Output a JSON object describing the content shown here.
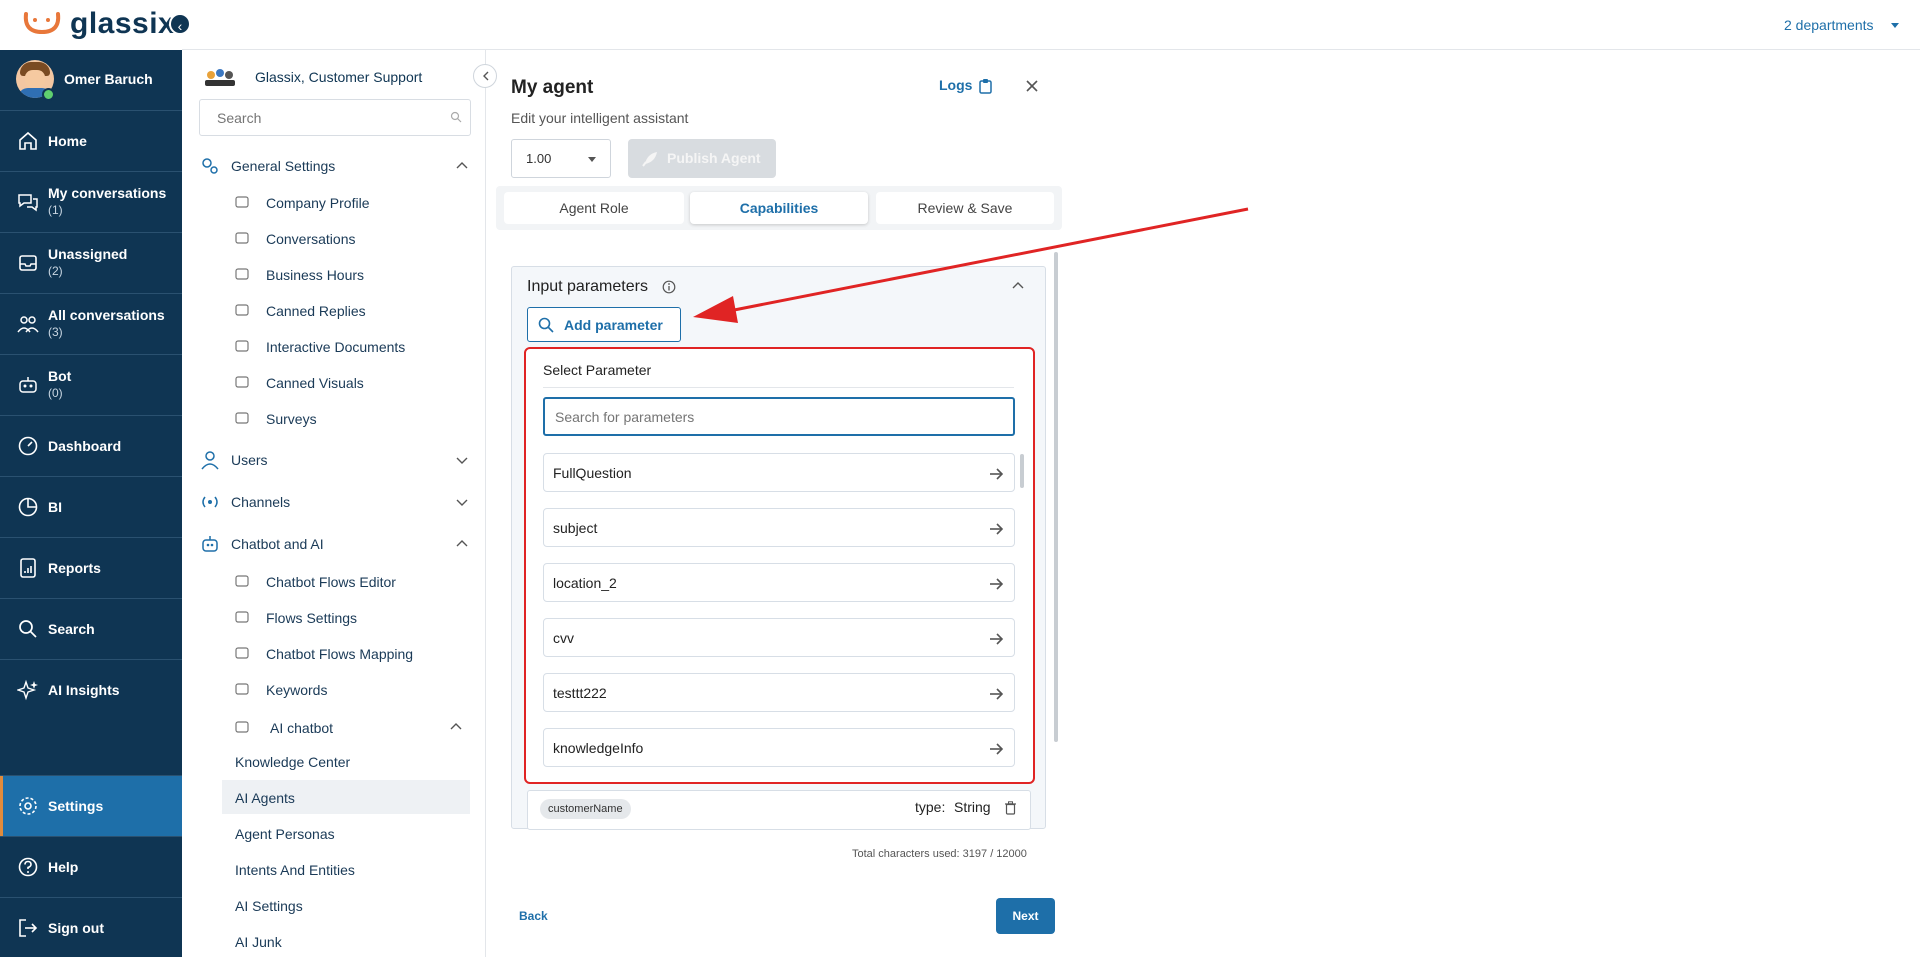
{
  "brand": {
    "name": "glassix",
    "accent": "#1e6fa9",
    "nav_bg": "#0f3553",
    "highlight": "#e02424"
  },
  "header": {
    "departments": "2 departments"
  },
  "user": {
    "name": "Omer Baruch",
    "status": "online"
  },
  "leftnav": {
    "items": [
      {
        "label": "Home",
        "count": "",
        "icon": "home-icon"
      },
      {
        "label": "My conversations",
        "count": "(1)",
        "icon": "chat-bubbles-icon"
      },
      {
        "label": "Unassigned",
        "count": "(2)",
        "icon": "inbox-icon"
      },
      {
        "label": "All conversations",
        "count": "(3)",
        "icon": "team-icon"
      },
      {
        "label": "Bot",
        "count": "(0)",
        "icon": "robot-icon"
      },
      {
        "label": "Dashboard",
        "count": "",
        "icon": "gauge-icon"
      },
      {
        "label": "BI",
        "count": "",
        "icon": "pie-chart-icon"
      },
      {
        "label": "Reports",
        "count": "",
        "icon": "report-icon"
      },
      {
        "label": "Search",
        "count": "",
        "icon": "search-icon"
      },
      {
        "label": "AI Insights",
        "count": "",
        "icon": "sparkle-icon"
      },
      {
        "label": "Settings",
        "count": "",
        "icon": "gear-icon"
      },
      {
        "label": "Help",
        "count": "",
        "icon": "help-icon"
      },
      {
        "label": "Sign out",
        "count": "",
        "icon": "sign-out-icon"
      }
    ]
  },
  "settings": {
    "org_name": "Glassix, Customer Support",
    "search_placeholder": "Search",
    "general": {
      "label": "General Settings",
      "items": [
        "Company Profile",
        "Conversations",
        "Business Hours",
        "Canned Replies",
        "Interactive Documents",
        "Canned Visuals",
        "Surveys"
      ]
    },
    "users_label": "Users",
    "channels_label": "Channels",
    "chatbot": {
      "label": "Chatbot and AI",
      "items": [
        "Chatbot Flows Editor",
        "Flows Settings",
        "Chatbot Flows Mapping",
        "Keywords",
        "AI chatbot"
      ],
      "ai_items": [
        "Knowledge Center",
        "AI Agents",
        "Agent Personas",
        "Intents And Entities",
        "AI Settings",
        "AI Junk"
      ]
    }
  },
  "agent": {
    "title": "My agent",
    "subtitle": "Edit your intelligent assistant",
    "logs_label": "Logs",
    "version": "1.00",
    "publish_label": "Publish Agent",
    "tabs": [
      "Agent Role",
      "Capabilities",
      "Review & Save"
    ],
    "active_tab": "Capabilities"
  },
  "input_params": {
    "title": "Input parameters",
    "add_label": "Add parameter",
    "select_title": "Select Parameter",
    "search_placeholder": "Search for parameters",
    "options": [
      "FullQuestion",
      "subject",
      "location_2",
      "cvv",
      "testtt222",
      "knowledgeInfo"
    ],
    "existing": {
      "name": "customerName",
      "type_label": "type:",
      "type": "String"
    }
  },
  "footer": {
    "total_chars": "Total characters used: 3197 / 12000",
    "back_label": "Back",
    "next_label": "Next"
  }
}
